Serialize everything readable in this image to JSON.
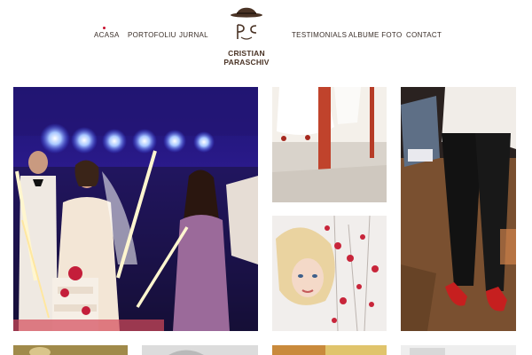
{
  "nav": {
    "left": [
      "ACASA",
      "PORTOFOLIU",
      "JURNAL"
    ],
    "right": [
      "TESTIMONIALS",
      "ALBUME FOTO",
      "CONTACT"
    ],
    "active": "ACASA",
    "accent": "#c8102e"
  },
  "logo": {
    "line1": "CRISTIAN",
    "line2": "PARASCHIV",
    "icon": "bowler-hat-icon",
    "color": "#4a3325"
  },
  "gallery": {
    "photos": [
      {
        "subject": "wedding-cake-sparklers-photo"
      },
      {
        "subject": "bride-wedding-dress-photo"
      },
      {
        "subject": "legs-red-shoes-photo"
      },
      {
        "subject": "blonde-woman-red-berries-photo"
      },
      {
        "subject": "bottom-row-photo-1"
      },
      {
        "subject": "bottom-row-photo-2"
      },
      {
        "subject": "bottom-row-photo-3"
      },
      {
        "subject": "bottom-row-photo-4"
      }
    ]
  }
}
